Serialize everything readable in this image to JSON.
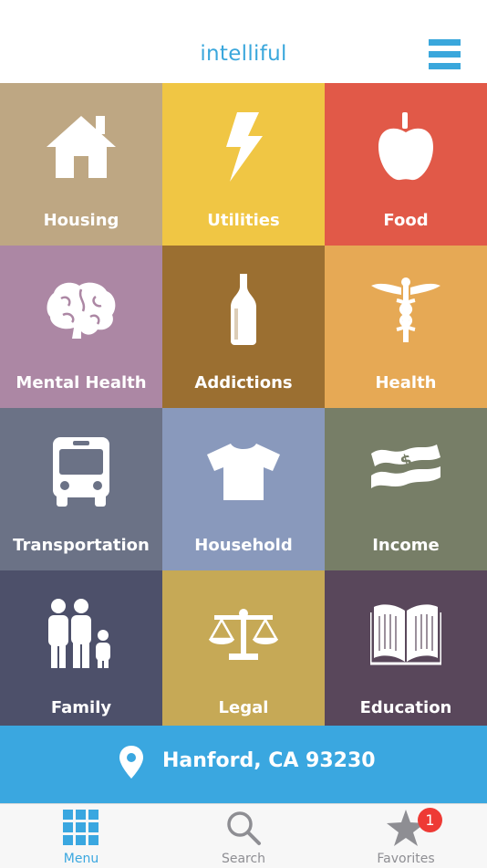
{
  "header": {
    "title": "intelliful",
    "menu_icon": "hamburger-icon",
    "accent": "#3aa7dc"
  },
  "categories": [
    {
      "label": "Housing",
      "icon": "house-icon",
      "color": "#bea783"
    },
    {
      "label": "Utilities",
      "icon": "lightning-icon",
      "color": "#f0c644"
    },
    {
      "label": "Food",
      "icon": "apple-icon",
      "color": "#e15948"
    },
    {
      "label": "Mental Health",
      "icon": "brain-icon",
      "color": "#ac87a4"
    },
    {
      "label": "Addictions",
      "icon": "bottle-icon",
      "color": "#9b6f31"
    },
    {
      "label": "Health",
      "icon": "caduceus-icon",
      "color": "#e6a955"
    },
    {
      "label": "Transportation",
      "icon": "bus-icon",
      "color": "#6b7286"
    },
    {
      "label": "Household",
      "icon": "shirt-icon",
      "color": "#8999bc"
    },
    {
      "label": "Income",
      "icon": "money-icon",
      "color": "#777e67"
    },
    {
      "label": "Family",
      "icon": "family-icon",
      "color": "#4d506a"
    },
    {
      "label": "Legal",
      "icon": "scales-icon",
      "color": "#c6a956"
    },
    {
      "label": "Education",
      "icon": "book-icon",
      "color": "#59475b"
    }
  ],
  "location": {
    "text": "Hanford, CA 93230",
    "icon": "location-pin-icon",
    "color": "#3aa7e0"
  },
  "tabs": [
    {
      "label": "Menu",
      "icon": "grid-icon",
      "active": true
    },
    {
      "label": "Search",
      "icon": "search-icon",
      "active": false
    },
    {
      "label": "Favorites",
      "icon": "star-icon",
      "active": false,
      "badge": "1"
    }
  ]
}
